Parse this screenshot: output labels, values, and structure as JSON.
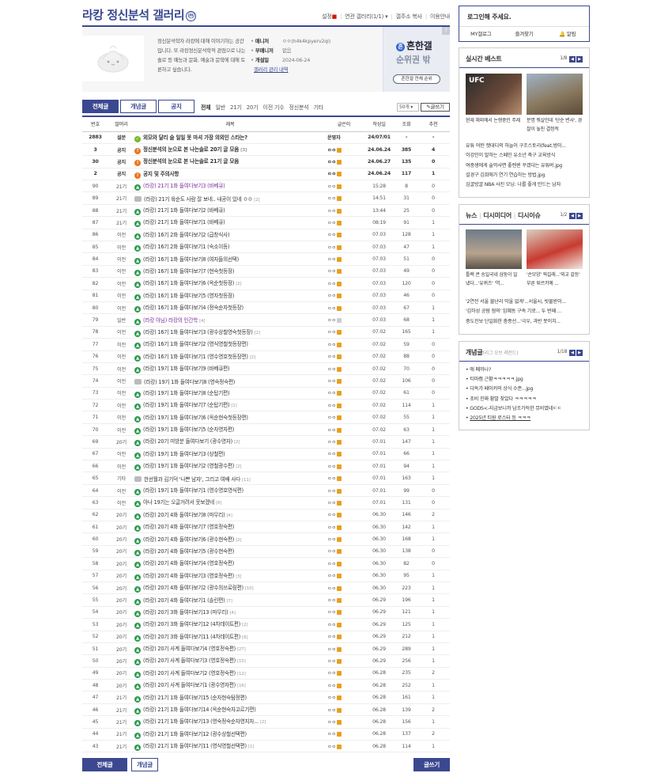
{
  "gallery": {
    "title": "라캉 정신분석 갤러리",
    "badge": "ⓜ",
    "links": [
      "설정",
      "연관 갤러리(1/1)",
      "갤주소 복사",
      "이용안내"
    ],
    "description": "정신분석학자 라캉에 대해 이야기하는 공간입니다. 또 라캉정신분석학적 관점으로 나는솔로 등 예능과 문화, 예술과 문학에 대해 토론하고 싶습니다.",
    "meta": [
      {
        "key": "매니저",
        "value": "ㅇㅇ(h4k4kpyerv2qi)"
      },
      {
        "key": "부매니저",
        "value": "없음"
      },
      {
        "key": "개설일",
        "value": "2024-06-24"
      }
    ],
    "manage_link": "갤러리 관리 내역"
  },
  "ad": {
    "logo": "흔한갤",
    "rank": "순위권 밖",
    "button": "흔한갤 전체 순위",
    "corner": "?"
  },
  "tabs": [
    "전체글",
    "개념글",
    "공지"
  ],
  "heads": [
    "전체",
    "일반",
    "21기",
    "20기",
    "이전 기수",
    "정신분석",
    "기타"
  ],
  "list_count": "50개",
  "write_label": "글쓰기",
  "columns": [
    "번호",
    "말머리",
    "제목",
    "글쓴이",
    "작성일",
    "조회",
    "추천"
  ],
  "posts": [
    {
      "no": "2883",
      "head": "설문",
      "icon": "survey",
      "title": "외모와 달리 술 일일 못 마셔 가장 의외인 스타는?",
      "comments": "",
      "writer": "운영자",
      "date": "24/07/01",
      "views": "-",
      "rec": "-",
      "notice": true
    },
    {
      "no": "3",
      "head": "공지",
      "icon": "notice",
      "title": "정신분석의 눈으로 본 나는솔로 20기 글 모음",
      "comments": "[3]",
      "writer": "ㅇㅇ",
      "date": "24.06.24",
      "views": "385",
      "rec": "4",
      "notice": true
    },
    {
      "no": "30",
      "head": "공지",
      "icon": "notice",
      "title": "정신분석의 눈으로 본 나는솔로 21기 글 모음",
      "comments": "",
      "writer": "ㅇㅇ",
      "date": "24.06.27",
      "views": "135",
      "rec": "0",
      "notice": true
    },
    {
      "no": "2",
      "head": "공지",
      "icon": "notice",
      "title": "공지 및 주의사항",
      "comments": "",
      "writer": "ㅇㅇ",
      "date": "24.06.24",
      "views": "117",
      "rec": "1",
      "notice": true
    },
    {
      "no": "90",
      "head": "21기",
      "icon": "img",
      "title": "(라캉) 21기 1화 들여다보기3 (바베큐)",
      "comments": "",
      "writer": "ㅇㅇ",
      "date": "15:28",
      "views": "8",
      "rec": "0",
      "visited": true
    },
    {
      "no": "89",
      "head": "21기",
      "icon": "txt",
      "title": "(라캉) 21기 육순도 사람 잘 보네.. 내공이 있네 ㅇㅇ",
      "comments": "[2]",
      "writer": "ㅇㅇ",
      "date": "14:51",
      "views": "31",
      "rec": "0"
    },
    {
      "no": "88",
      "head": "21기",
      "icon": "img",
      "title": "(라캉) 21기 1화 들여다보기2 (바베큐)",
      "comments": "",
      "writer": "ㅇㅇ",
      "date": "13:44",
      "views": "25",
      "rec": "0"
    },
    {
      "no": "87",
      "head": "21기",
      "icon": "img",
      "title": "(라캉) 21기 1화 들여다보기1 (바베큐)",
      "comments": "",
      "writer": "ㅇㅇ",
      "date": "08:19",
      "views": "91",
      "rec": "1"
    },
    {
      "no": "86",
      "head": "이전",
      "icon": "img",
      "title": "(라캉) 16기 2화 들여다보기2 (급창식사)",
      "comments": "",
      "writer": "ㅇㅇ",
      "date": "07.03",
      "views": "128",
      "rec": "1"
    },
    {
      "no": "85",
      "head": "이전",
      "icon": "img",
      "title": "(라캉) 16기 2화 들여다보기1 (숙소이동)",
      "comments": "",
      "writer": "ㅇㅇ",
      "date": "07.03",
      "views": "47",
      "rec": "1"
    },
    {
      "no": "84",
      "head": "이전",
      "icon": "img",
      "title": "(라캉) 16기 1화 들여다보기8 (여자들의선택)",
      "comments": "",
      "writer": "ㅇㅇ",
      "date": "07.03",
      "views": "51",
      "rec": "0"
    },
    {
      "no": "83",
      "head": "이전",
      "icon": "img",
      "title": "(라캉) 16기 1화 들여다보기7 (현숙첫등장)",
      "comments": "",
      "writer": "ㅇㅇ",
      "date": "07.03",
      "views": "49",
      "rec": "0"
    },
    {
      "no": "82",
      "head": "이전",
      "icon": "img",
      "title": "(라캉) 16기 1화 들여다보기6 (옥순첫등장)",
      "comments": "[2]",
      "writer": "ㅇㅇ",
      "date": "07.03",
      "views": "120",
      "rec": "0"
    },
    {
      "no": "81",
      "head": "이전",
      "icon": "img",
      "title": "(라캉) 16기 1화 들여다보기5 (영자첫등장)",
      "comments": "",
      "writer": "ㅇㅇ",
      "date": "07.03",
      "views": "46",
      "rec": "0"
    },
    {
      "no": "80",
      "head": "이전",
      "icon": "img",
      "title": "(라캉) 16기 1화 들여다보기4 (정숙순자첫등장)",
      "comments": "",
      "writer": "ㅇㅇ",
      "date": "07.03",
      "views": "67",
      "rec": "1"
    },
    {
      "no": "79",
      "head": "일반",
      "icon": "img",
      "title": "(라캉 아님) 라캉의 인간학",
      "comments": "[4]",
      "writer": "ㅇㅇ",
      "date": "07.03",
      "views": "68",
      "rec": "1",
      "visited": true,
      "gray": true
    },
    {
      "no": "78",
      "head": "이전",
      "icon": "img",
      "title": "(라캉) 16기 1화 들여다보기3 (광수상철영숙첫등장)",
      "comments": "[2]",
      "writer": "ㅇㅇ",
      "date": "07.02",
      "views": "165",
      "rec": "1"
    },
    {
      "no": "77",
      "head": "이전",
      "icon": "img",
      "title": "(라캉) 16기 1화 들여다보기2 (영식영철첫등장편)",
      "comments": "",
      "writer": "ㅇㅇ",
      "date": "07.02",
      "views": "59",
      "rec": "0"
    },
    {
      "no": "76",
      "head": "이전",
      "icon": "img",
      "title": "(라캉) 16기 1화 들여다보기1 (영수영호첫등장편)",
      "comments": "[2]",
      "writer": "ㅇㅇ",
      "date": "07.02",
      "views": "88",
      "rec": "0"
    },
    {
      "no": "75",
      "head": "이전",
      "icon": "img",
      "title": "(라캉) 19기 1화 들여다보기9 (바베큐편)",
      "comments": "",
      "writer": "ㅇㅇ",
      "date": "07.02",
      "views": "70",
      "rec": "0"
    },
    {
      "no": "74",
      "head": "이전",
      "icon": "txt",
      "title": "(라캉) 19기 1화 들여다보기8 (영숙정숙편)",
      "comments": "",
      "writer": "ㅇㅇ",
      "date": "07.02",
      "views": "106",
      "rec": "0"
    },
    {
      "no": "73",
      "head": "이전",
      "icon": "img",
      "title": "(라캉) 19기 1화 들여다보기8 (순탑기편)",
      "comments": "",
      "writer": "ㅇㅇ",
      "date": "07.02",
      "views": "61",
      "rec": "0"
    },
    {
      "no": "72",
      "head": "이전",
      "icon": "img",
      "title": "(라캉) 19기 1화 들여다보기7 (순탑기편)",
      "comments": "[1]",
      "writer": "ㅇㅇ",
      "date": "07.02",
      "views": "114",
      "rec": "1"
    },
    {
      "no": "71",
      "head": "이전",
      "icon": "img",
      "title": "(라캉) 19기 1화 들여다보기6 (옥순현숙첫등장편)",
      "comments": "",
      "writer": "ㅇㅇ",
      "date": "07.02",
      "views": "55",
      "rec": "1"
    },
    {
      "no": "70",
      "head": "이전",
      "icon": "img",
      "title": "(라캉) 19기 1화 들여다보기5 (순자영자편)",
      "comments": "",
      "writer": "ㅇㅇ",
      "date": "07.02",
      "views": "63",
      "rec": "1"
    },
    {
      "no": "69",
      "head": "20기",
      "icon": "img",
      "title": "(라캉) 20기 미방분 들여다보기 (광수영자)",
      "comments": "[2]",
      "writer": "ㅇㅇ",
      "date": "07.01",
      "views": "147",
      "rec": "1"
    },
    {
      "no": "67",
      "head": "이전",
      "icon": "img",
      "title": "(라캉) 19기 1화 들여다보기3 (상철편)",
      "comments": "",
      "writer": "ㅇㅇ",
      "date": "07.01",
      "views": "66",
      "rec": "1"
    },
    {
      "no": "66",
      "head": "이전",
      "icon": "img",
      "title": "(라캉) 19기 1화 들여다보기2 (영철광수편)",
      "comments": "[2]",
      "writer": "ㅇㅇ",
      "date": "07.01",
      "views": "94",
      "rec": "1"
    },
    {
      "no": "65",
      "head": "기타",
      "icon": "txt",
      "title": "한선월과 김기덕 '나쁜 남자', 그리고 여배 사다",
      "comments": "[11]",
      "writer": "ㅇㅇ",
      "date": "07.01",
      "views": "163",
      "rec": "1"
    },
    {
      "no": "64",
      "head": "이전",
      "icon": "img",
      "title": "(라캉) 19기 1화 들여다보기1 (영수영호영식편)",
      "comments": "",
      "writer": "ㅇㅇ",
      "date": "07.01",
      "views": "99",
      "rec": "0"
    },
    {
      "no": "63",
      "head": "이전",
      "icon": "img",
      "title": "아나 19기는 오글거려서 못보겠네",
      "comments": "[8]",
      "writer": "ㅇㅇ",
      "date": "07.01",
      "views": "131",
      "rec": "0"
    },
    {
      "no": "62",
      "head": "20기",
      "icon": "img",
      "title": "(라캉) 20기 4화 들여다보기8 (마무리)",
      "comments": "[4]",
      "writer": "ㅇㅇ",
      "date": "06.30",
      "views": "146",
      "rec": "2"
    },
    {
      "no": "61",
      "head": "20기",
      "icon": "img",
      "title": "(라캉) 20기 4화 들여다보기7 (영호정숙편)",
      "comments": "",
      "writer": "ㅇㅇ",
      "date": "06.30",
      "views": "142",
      "rec": "1"
    },
    {
      "no": "60",
      "head": "20기",
      "icon": "img",
      "title": "(라캉) 20기 4화 들여다보기6 (광수현숙편)",
      "comments": "[2]",
      "writer": "ㅇㅇ",
      "date": "06.30",
      "views": "168",
      "rec": "1"
    },
    {
      "no": "59",
      "head": "20기",
      "icon": "img",
      "title": "(라캉) 20기 4화 들여다보기5 (광수현숙편)",
      "comments": "",
      "writer": "ㅇㅇ",
      "date": "06.30",
      "views": "138",
      "rec": "0"
    },
    {
      "no": "58",
      "head": "20기",
      "icon": "img",
      "title": "(라캉) 20기 4화 들여다보기4 (영호정숙편)",
      "comments": "",
      "writer": "ㅇㅇ",
      "date": "06.30",
      "views": "82",
      "rec": "0"
    },
    {
      "no": "57",
      "head": "20기",
      "icon": "img",
      "title": "(라캉) 20기 4화 들여다보기3 (영호정숙편)",
      "comments": "[3]",
      "writer": "ㅇㅇ",
      "date": "06.30",
      "views": "95",
      "rec": "1"
    },
    {
      "no": "56",
      "head": "20기",
      "icon": "img",
      "title": "(라캉) 20기 4화 들여다보기2 (광수의쓰로링편)",
      "comments": "[10]",
      "writer": "ㅇㅇ",
      "date": "06.30",
      "views": "223",
      "rec": "1"
    },
    {
      "no": "55",
      "head": "20기",
      "icon": "img",
      "title": "(라캉) 20기 4화 들여다보기1 (솔린편)",
      "comments": "[7]",
      "writer": "ㅇㅇ",
      "date": "06.29",
      "views": "196",
      "rec": "1"
    },
    {
      "no": "54",
      "head": "20기",
      "icon": "img",
      "title": "(라캉) 20기 3화 들여다보기13 (마무리)",
      "comments": "[4]",
      "writer": "ㅇㅇ",
      "date": "06.29",
      "views": "121",
      "rec": "1"
    },
    {
      "no": "53",
      "head": "20기",
      "icon": "img",
      "title": "(라캉) 20기 3화 들여다보기12 (4차데이트편)",
      "comments": "[2]",
      "writer": "ㅇㅇ",
      "date": "06.29",
      "views": "125",
      "rec": "1"
    },
    {
      "no": "52",
      "head": "20기",
      "icon": "img",
      "title": "(라캉) 20기 3화 들여다보기11 (4차데이트편)",
      "comments": "[6]",
      "writer": "ㅇㅇ",
      "date": "06.29",
      "views": "212",
      "rec": "1"
    },
    {
      "no": "51",
      "head": "20기",
      "icon": "img",
      "title": "(라캉) 20기 사계 들여다보기4 (영호정숙편)",
      "comments": "[27]",
      "writer": "ㅇㅇ",
      "date": "06.29",
      "views": "289",
      "rec": "1"
    },
    {
      "no": "50",
      "head": "20기",
      "icon": "img",
      "title": "(라캉) 20기 사계 들여다보기3 (영호정숙편)",
      "comments": "[15]",
      "writer": "ㅇㅇ",
      "date": "06.29",
      "views": "256",
      "rec": "1"
    },
    {
      "no": "49",
      "head": "20기",
      "icon": "img",
      "title": "(라캉) 20기 사계 들여다보기2 (영호정숙편)",
      "comments": "[12]",
      "writer": "ㅇㅇ",
      "date": "06.28",
      "views": "235",
      "rec": "2"
    },
    {
      "no": "48",
      "head": "20기",
      "icon": "img",
      "title": "(라캉) 20기 사계 들여다보기1 (광수영자편)",
      "comments": "[16]",
      "writer": "ㅇㅇ",
      "date": "06.28",
      "views": "252",
      "rec": "1"
    },
    {
      "no": "47",
      "head": "21기",
      "icon": "img",
      "title": "(라캉) 21기 1화 들여다보기15 (순자현숙탐정편)",
      "comments": "",
      "writer": "ㅇㅇ",
      "date": "06.28",
      "views": "161",
      "rec": "1"
    },
    {
      "no": "46",
      "head": "21기",
      "icon": "img",
      "title": "(라캉) 21기 1화 들여다보기14 (옥순현숙자고르기편)",
      "comments": "",
      "writer": "ㅇㅇ",
      "date": "06.28",
      "views": "139",
      "rec": "2"
    },
    {
      "no": "45",
      "head": "21기",
      "icon": "img",
      "title": "(라캉) 21기 1화 들여다보기13 (영숙정숙순자영지자...",
      "comments": "[2]",
      "writer": "ㅇㅇ",
      "date": "06.28",
      "views": "156",
      "rec": "1"
    },
    {
      "no": "44",
      "head": "21기",
      "icon": "img",
      "title": "(라캉) 21기 1화 들여다보기12 (광수상철선택편)",
      "comments": "",
      "writer": "ㅇㅇ",
      "date": "06.28",
      "views": "137",
      "rec": "2"
    },
    {
      "no": "43",
      "head": "21기",
      "icon": "img",
      "title": "(라캉) 21기 1화 들여다보기11 (영식영철선택편)",
      "comments": "[1]",
      "writer": "ㅇㅇ",
      "date": "06.28",
      "views": "114",
      "rec": "1"
    }
  ],
  "bottom": {
    "all": "전체글",
    "concept": "개념글",
    "write": "글쓰기"
  },
  "login": {
    "title": "로그인해 주세요.",
    "items": [
      "MY갤로그",
      "즐겨찾기",
      "알림"
    ]
  },
  "realtime": {
    "title": "실시간 베스트",
    "page": "1/8",
    "captions": [
      "현재 해외에서 논쟁중인 주제",
      "분명 뭐살인데 '단순 변사', 경찰이 놓친 결정적"
    ],
    "items": [
      "유튜 어떤 잿대디의 하늘이 구조스토리(feat.범이...",
      "이강인이 말하는 스페인 유소년 축구 교육방식",
      "여중생에게 술먹사면 좋렌퀸 꾸겠다는 유튜버.jpg",
      "설경구 김희애가 연기 연습하는 방법.jpg",
      "심굴방굴 NBA 사진 모닝: 나를 좋게 만드는 남자"
    ]
  },
  "news": {
    "tabs": [
      "뉴스",
      "디시미디어",
      "디시이슈"
    ],
    "page": "1/2",
    "captions": [
      "틀렉 콘 송일국네 삼둥이 일 냈다...'유퀴즈' '역...",
      "'손모양' 픽길래...'외교 갈등' 부른 튀르키예 ..."
    ],
    "items": [
      "'2연전 서울 불난리 막울 없게'...서울시, 빗물받이...",
      "'김하성 공람 혐의' 임혜동 구속 기로... 두 번째 ...",
      "중도진보 단일화한 충종선...'극우, 과반 못이치..."
    ]
  },
  "concept": {
    "title": "개념글",
    "sub": "(리그 오브 레전드)",
    "page": "1/18",
    "items": [
      "애 폐까나?",
      "티마캠 근황ㅋㅋㅋㅋㅋ.jpg",
      "다독가 페이커의 상식 수준...jpg",
      "초비 진짜 황발 찾았다 ㅋㅋㅋㅋㅋ",
      "GODS<-지금보니까 남조가득한 뮤비였네ㄷㄷ",
      "2025년 티원 로스터 등 ㅋㅋㅋ"
    ]
  },
  "colors": {
    "accent": "#3b4890",
    "notice": "#e87722",
    "image_icon": "#2e9a50",
    "visited": "#7b2d9b"
  }
}
